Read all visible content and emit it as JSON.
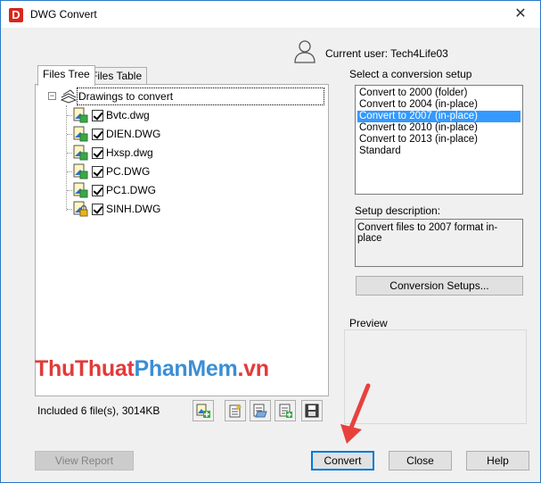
{
  "window": {
    "title": "DWG Convert",
    "app_icon_letter": "D",
    "close_glyph": "✕"
  },
  "user": {
    "label": "Current user: Tech4Life03"
  },
  "tabs": [
    {
      "label": "Files Tree",
      "active": true
    },
    {
      "label": "Files Table",
      "active": false
    }
  ],
  "tree": {
    "expander": "−",
    "root_label": "Drawings to convert",
    "files": [
      {
        "name": "Bvtc.dwg",
        "checked": true
      },
      {
        "name": "DIEN.DWG",
        "checked": true
      },
      {
        "name": "Hxsp.dwg",
        "checked": true
      },
      {
        "name": "PC.DWG",
        "checked": true
      },
      {
        "name": "PC1.DWG",
        "checked": true
      },
      {
        "name": "SINH.DWG",
        "checked": true
      }
    ]
  },
  "status": {
    "text": "Included 6 file(s), 3014KB"
  },
  "conversion": {
    "group_label": "Select a conversion setup",
    "options": [
      "Convert to 2000 (folder)",
      "Convert to 2004 (in-place)",
      "Convert to 2007 (in-place)",
      "Convert to 2010 (in-place)",
      "Convert to 2013 (in-place)",
      "Standard"
    ],
    "selected_index": 2,
    "desc_label": "Setup description:",
    "description": "Convert files to 2007 format in-place",
    "setups_button": "Conversion Setups..."
  },
  "preview": {
    "label": "Preview"
  },
  "watermark": {
    "part1": "ThuThuat",
    "part2": "PhanMem",
    "part3": ".vn"
  },
  "buttons": {
    "view_report": "View Report",
    "convert": "Convert",
    "close": "Close",
    "help": "Help"
  },
  "colors": {
    "accent": "#0078d7",
    "selection": "#3399ff",
    "arrow": "#e8413c",
    "app_icon": "#d9261c"
  }
}
